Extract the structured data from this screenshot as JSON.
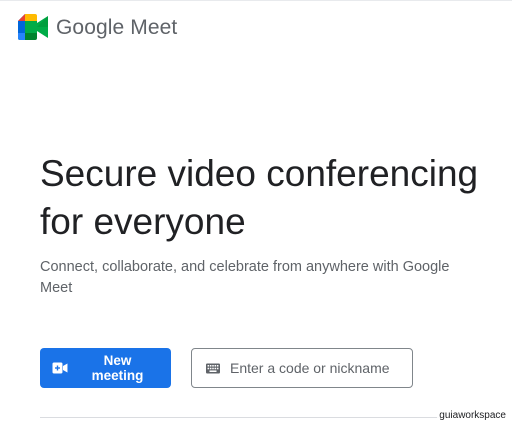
{
  "header": {
    "brand_name": "Google Meet",
    "logo_icon": "google-meet-logo-icon"
  },
  "hero": {
    "title": "Secure video conferencing for everyone",
    "subtitle": "Connect, collaborate, and celebrate from anywhere with Google Meet"
  },
  "actions": {
    "new_meeting_label": "New meeting",
    "new_meeting_icon": "video-plus-icon",
    "code_placeholder": "Enter a code or nickname",
    "code_value": "",
    "code_icon": "keyboard-icon"
  },
  "watermark": "guiaworkspace",
  "colors": {
    "primary": "#1a73e8",
    "text_primary": "#202124",
    "text_secondary": "#5f6368",
    "logo_green": "#00832d",
    "logo_blue": "#0066da",
    "logo_red": "#e94235",
    "logo_yellow": "#ffba00",
    "logo_green_light": "#00ac47",
    "logo_blue_light": "#2684fc"
  }
}
